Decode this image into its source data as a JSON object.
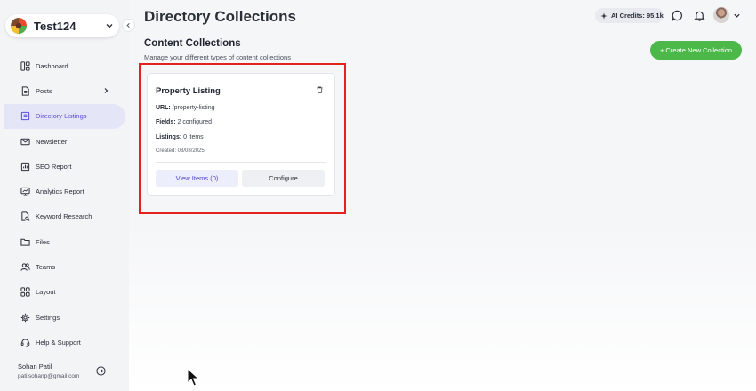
{
  "sidebar": {
    "workspace_name": "Test124",
    "items": [
      {
        "label": "Dashboard",
        "icon": "dashboard-icon"
      },
      {
        "label": "Posts",
        "icon": "posts-icon"
      },
      {
        "label": "Directory Listings",
        "icon": "directory-icon"
      },
      {
        "label": "Newsletter",
        "icon": "mail-icon"
      },
      {
        "label": "SEO Report",
        "icon": "report-icon"
      },
      {
        "label": "Analytics Report",
        "icon": "analytics-icon"
      },
      {
        "label": "Keyword Research",
        "icon": "search-doc-icon"
      },
      {
        "label": "Files",
        "icon": "folder-icon"
      },
      {
        "label": "Teams",
        "icon": "users-icon"
      },
      {
        "label": "Layout",
        "icon": "grid-icon"
      },
      {
        "label": "Settings",
        "icon": "gear-icon"
      },
      {
        "label": "Help & Support",
        "icon": "headset-icon"
      }
    ],
    "active_item": "Directory Listings",
    "user": {
      "name": "Sohan Patil",
      "email": "patilsohanp@gmail.com"
    }
  },
  "header": {
    "title": "Directory Collections",
    "credits": "AI Credits: 95.1k"
  },
  "main": {
    "section_title": "Content Collections",
    "section_subtitle": "Manage your different types of content collections",
    "create_button": "+ Create New Collection"
  },
  "card": {
    "title": "Property Listing",
    "url_label": "URL:",
    "url_value": " /property-listing",
    "fields_label": "Fields:",
    "fields_value": " 2 configured",
    "listings_label": "Listings:",
    "listings_value": " 0 items",
    "created": "Created: 08/08/2025",
    "view_button": "View Items (0)",
    "configure_button": "Configure"
  },
  "colors": {
    "accent": "#5b4fd8",
    "create_button": "#4cb84a",
    "highlight": "#e3211f"
  }
}
